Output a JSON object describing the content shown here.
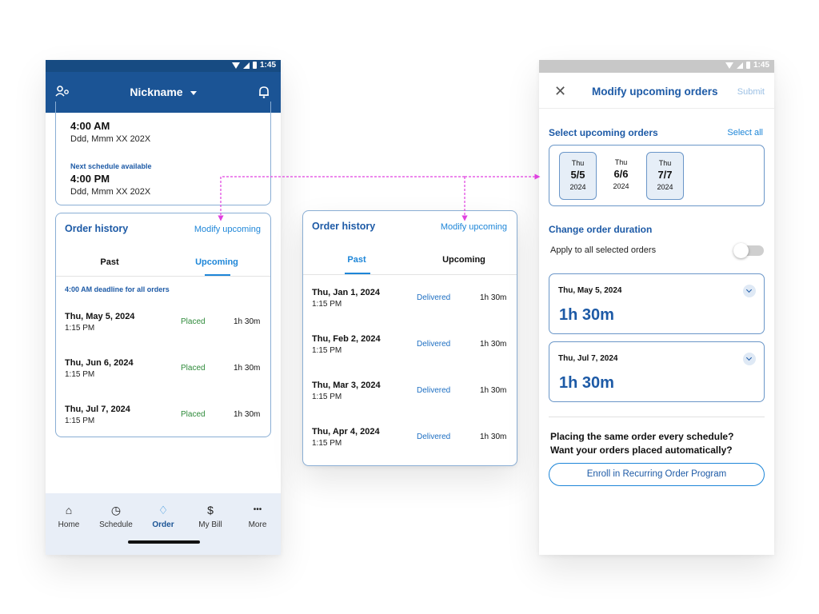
{
  "phone1": {
    "status_time": "1:45",
    "header_title": "Nickname",
    "schedule": {
      "time1": "4:00 AM",
      "date1": "Ddd, Mmm XX 202X",
      "next_label": "Next schedule available",
      "time2": "4:00 PM",
      "date2": "Ddd, Mmm XX 202X"
    },
    "history": {
      "title": "Order history",
      "modify_link": "Modify upcoming",
      "tab_past": "Past",
      "tab_upcoming": "Upcoming",
      "deadline_note": "4:00 AM deadline for all orders",
      "rows": [
        {
          "date": "Thu, May 5, 2024",
          "time": "1:15 PM",
          "status": "Placed",
          "duration": "1h 30m"
        },
        {
          "date": "Thu, Jun 6, 2024",
          "time": "1:15 PM",
          "status": "Placed",
          "duration": "1h 30m"
        },
        {
          "date": "Thu, Jul 7, 2024",
          "time": "1:15 PM",
          "status": "Placed",
          "duration": "1h 30m"
        }
      ]
    },
    "nav": [
      {
        "label": "Home",
        "icon": "home-icon",
        "glyph": "⌂"
      },
      {
        "label": "Schedule",
        "icon": "clock-icon",
        "glyph": "◷"
      },
      {
        "label": "Order",
        "icon": "water-drop-icon",
        "glyph": "♢"
      },
      {
        "label": "My Bill",
        "icon": "dollar-icon",
        "glyph": "$"
      },
      {
        "label": "More",
        "icon": "more-dots-icon",
        "glyph": "•••"
      }
    ]
  },
  "middle": {
    "title": "Order history",
    "modify_link": "Modify upcoming",
    "tab_past": "Past",
    "tab_upcoming": "Upcoming",
    "rows": [
      {
        "date": "Thu, Jan 1, 2024",
        "time": "1:15 PM",
        "status": "Delivered",
        "duration": "1h 30m"
      },
      {
        "date": "Thu, Feb 2, 2024",
        "time": "1:15 PM",
        "status": "Delivered",
        "duration": "1h 30m"
      },
      {
        "date": "Thu, Mar 3, 2024",
        "time": "1:15 PM",
        "status": "Delivered",
        "duration": "1h 30m"
      },
      {
        "date": "Thu, Apr 4, 2024",
        "time": "1:15 PM",
        "status": "Delivered",
        "duration": "1h 30m"
      }
    ]
  },
  "phone2": {
    "status_time": "1:45",
    "title": "Modify upcoming orders",
    "submit_label": "Submit",
    "select_title": "Select upcoming orders",
    "select_all": "Select all",
    "dates": [
      {
        "dow": "Thu",
        "md": "5/5",
        "year": "2024",
        "selected": true
      },
      {
        "dow": "Thu",
        "md": "6/6",
        "year": "2024",
        "selected": false
      },
      {
        "dow": "Thu",
        "md": "7/7",
        "year": "2024",
        "selected": true
      }
    ],
    "duration_title": "Change order duration",
    "apply_all": "Apply to all selected orders",
    "durations": [
      {
        "date": "Thu, May 5, 2024",
        "value": "1h 30m"
      },
      {
        "date": "Thu, Jul 7, 2024",
        "value": "1h 30m"
      }
    ],
    "promo_line1": "Placing the same order every schedule?",
    "promo_line2": "Want your orders placed automatically?",
    "enroll_label": "Enroll in Recurring Order Program"
  },
  "colors": {
    "header_blue": "#1b5495",
    "accent_blue": "#1e86d8",
    "placed_green": "#2e8a3a",
    "connector_magenta": "#e040e0"
  }
}
